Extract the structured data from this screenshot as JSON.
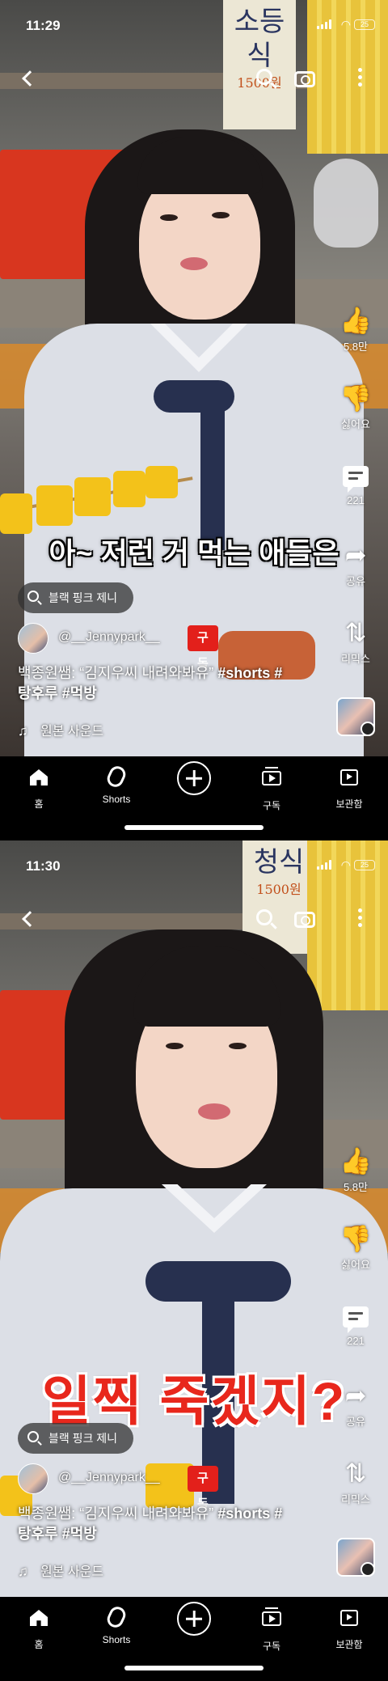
{
  "screens": [
    {
      "status": {
        "time": "11:29",
        "battery": "25"
      },
      "caption": "아~ 저런 거 먹는 애들은",
      "sign": {
        "text": "소등식",
        "price": "1500원"
      },
      "search_pill": "블랙 핑크 제니",
      "channel": {
        "name": "@__Jennypark__",
        "subscribe": "구독"
      },
      "title_text": "백종원쌤: “김지우씨 내려와봐유”",
      "title_tags1": " #shorts #",
      "title_line2": "탕후루 #먹방",
      "sound": "원본 사운드",
      "actions": {
        "like_count": "5.8만",
        "dislike": "싫어요",
        "comments": "221",
        "share": "공유",
        "remix": "리믹스"
      }
    },
    {
      "status": {
        "time": "11:30",
        "battery": "25"
      },
      "caption": "일찍 죽겠지?",
      "sign": {
        "text": "청식",
        "price": "1500원"
      },
      "search_pill": "블랙 핑크 제니",
      "channel": {
        "name": "@__Jennypark__",
        "subscribe": "구독"
      },
      "title_text": "백종원쌤: “김지우씨 내려와봐유”",
      "title_tags1": " #shorts #",
      "title_line2": "탕후루 #먹방",
      "sound": "원본 사운드",
      "actions": {
        "like_count": "5.8만",
        "dislike": "싫어요",
        "comments": "221",
        "share": "공유",
        "remix": "리믹스"
      }
    }
  ],
  "nav": {
    "home": "홈",
    "shorts": "Shorts",
    "create": "",
    "subscriptions": "구독",
    "library": "보관함"
  },
  "icons": [
    "back-icon",
    "search-icon",
    "camera-icon",
    "more-icon",
    "like-icon",
    "dislike-icon",
    "comment-icon",
    "share-icon",
    "remix-icon",
    "home-icon",
    "shorts-icon",
    "create-icon",
    "subscriptions-icon",
    "library-icon",
    "music-note-icon"
  ],
  "colors": {
    "subscribe": "#e3201b",
    "caption_red": "#e8271c",
    "background": "#000000"
  }
}
